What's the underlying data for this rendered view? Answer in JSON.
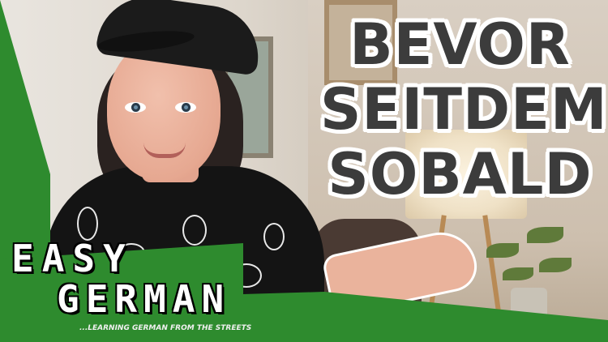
{
  "title_lines": [
    "BEVOR",
    "SEITDEM",
    "SOBALD"
  ],
  "logo": {
    "line1": "EASY",
    "line2": "GERMAN",
    "tagline": "...LEARNING GERMAN FROM THE STREETS"
  },
  "colors": {
    "brand_green": "#2e8b2e",
    "title_text": "#3c3c3c",
    "title_outline": "#ffffff"
  }
}
